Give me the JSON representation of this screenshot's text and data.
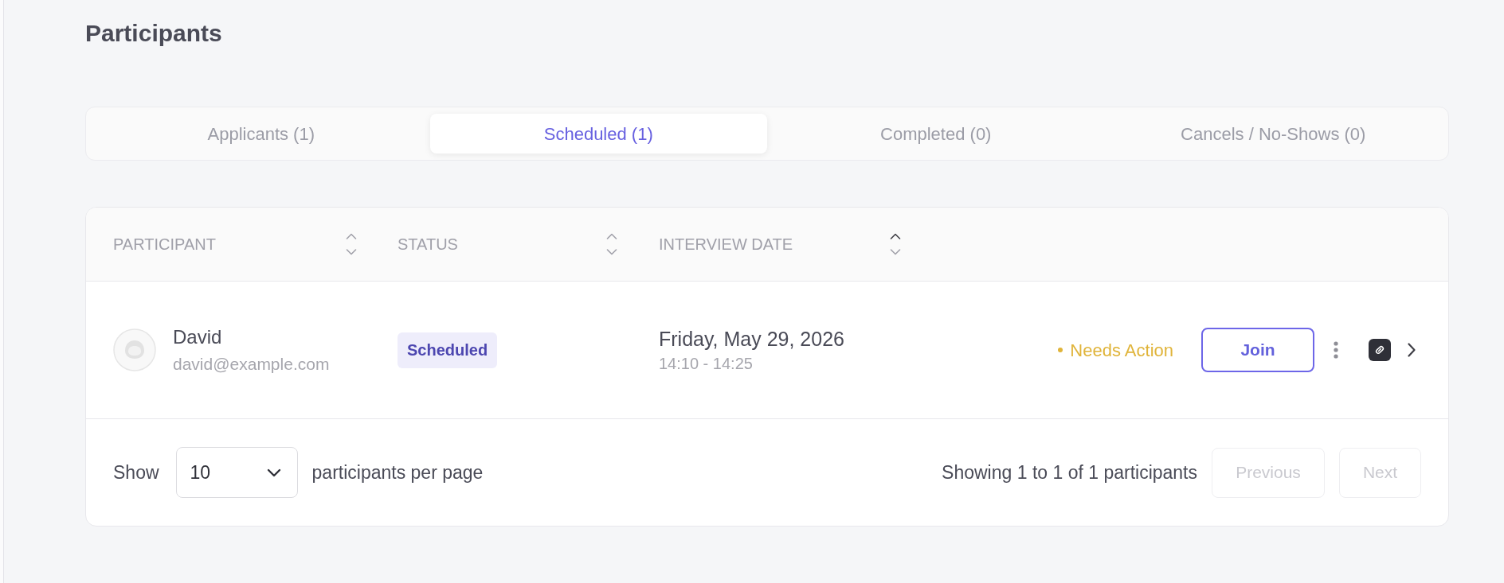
{
  "page": {
    "title": "Participants"
  },
  "tabs": [
    {
      "label": "Applicants (1)",
      "selected": false
    },
    {
      "label": "Scheduled (1)",
      "selected": true
    },
    {
      "label": "Completed (0)",
      "selected": false
    },
    {
      "label": "Cancels / No-Shows (0)",
      "selected": false
    }
  ],
  "table": {
    "columns": [
      {
        "label": "PARTICIPANT",
        "sorted": false
      },
      {
        "label": "STATUS",
        "sorted": false
      },
      {
        "label": "INTERVIEW DATE",
        "sorted": true
      }
    ],
    "rows": [
      {
        "name": "David",
        "email": "david@example.com",
        "status": "Scheduled",
        "date": "Friday, May 29, 2026",
        "time": "14:10 - 14:25",
        "action_status": "Needs Action",
        "join_label": "Join"
      }
    ]
  },
  "pagination": {
    "show_label": "Show",
    "page_size": "10",
    "per_page_label": "participants per page",
    "summary": "Showing 1 to 1 of 1 participants",
    "previous": {
      "label": "Previous",
      "disabled": true
    },
    "next": {
      "label": "Next",
      "disabled": true
    }
  }
}
